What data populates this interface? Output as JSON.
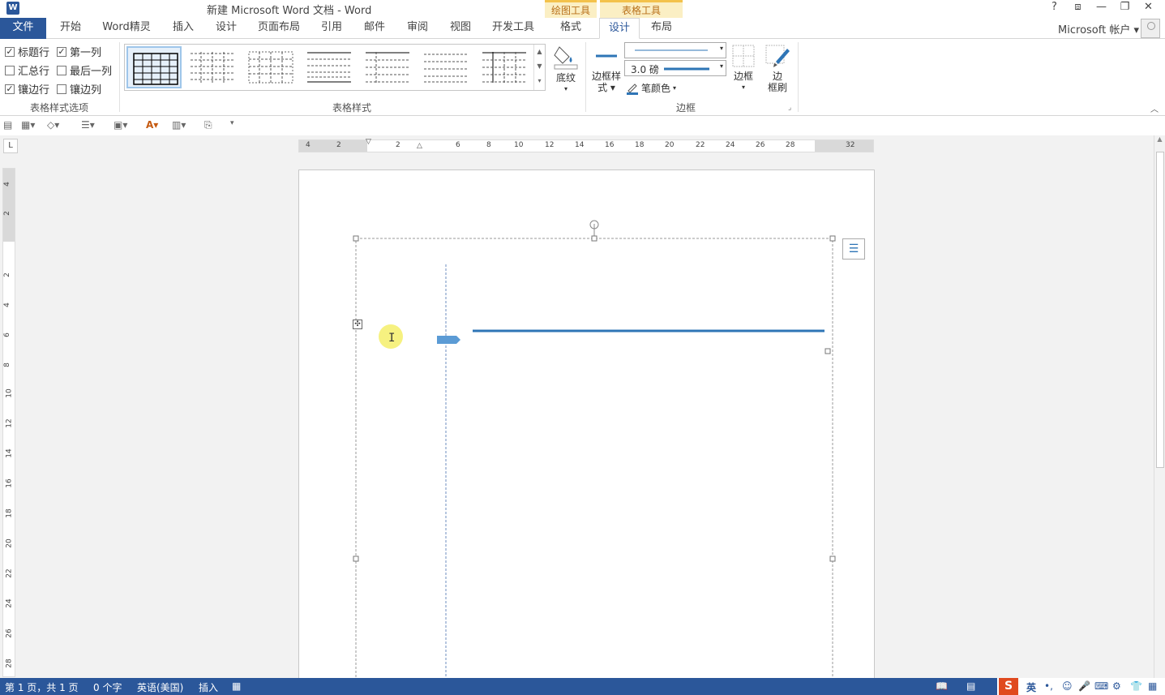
{
  "window": {
    "title": "新建 Microsoft Word 文档 - Word",
    "app_icon": "W",
    "context_groups": [
      "绘图工具",
      "表格工具"
    ],
    "controls": [
      "?",
      "⧈",
      "—",
      "❐",
      "✕"
    ]
  },
  "tabs": {
    "file": "文件",
    "items": [
      "开始",
      "Word精灵",
      "插入",
      "设计",
      "页面布局",
      "引用",
      "邮件",
      "审阅",
      "视图",
      "开发工具",
      "格式",
      "设计",
      "布局"
    ],
    "active_index": 11,
    "account": "Microsoft 帐户 ▾"
  },
  "ribbon": {
    "style_options": {
      "label": "表格样式选项",
      "checkboxes": [
        {
          "label": "标题行",
          "checked": true
        },
        {
          "label": "第一列",
          "checked": true
        },
        {
          "label": "汇总行",
          "checked": false
        },
        {
          "label": "最后一列",
          "checked": false
        },
        {
          "label": "镶边行",
          "checked": true
        },
        {
          "label": "镶边列",
          "checked": false
        }
      ]
    },
    "table_styles": {
      "label": "表格样式"
    },
    "shading": {
      "label": "底纹"
    },
    "borders": {
      "label": "边框",
      "border_styles_label_1": "边框样",
      "border_styles_label_2": "式",
      "weight": "3.0 磅",
      "pen_color": "笔颜色",
      "borders_btn": "边框",
      "painter_1": "边",
      "painter_2": "框刷"
    },
    "accent": "#2e75b6"
  },
  "ruler": {
    "h_ticks": [
      "4",
      "2",
      "2",
      "6",
      "8",
      "10",
      "12",
      "14",
      "16",
      "18",
      "20",
      "22",
      "24",
      "26",
      "28",
      "32"
    ],
    "v_ticks": [
      "4",
      "2",
      "2",
      "4",
      "6",
      "8",
      "10",
      "12",
      "14",
      "16",
      "18",
      "20",
      "22",
      "24",
      "26",
      "28"
    ],
    "corner": "L"
  },
  "status": {
    "page": "第 1 页，共 1 页",
    "words": "0 个字",
    "language": "英语(美国)",
    "mode": "插入",
    "ime": "英"
  }
}
